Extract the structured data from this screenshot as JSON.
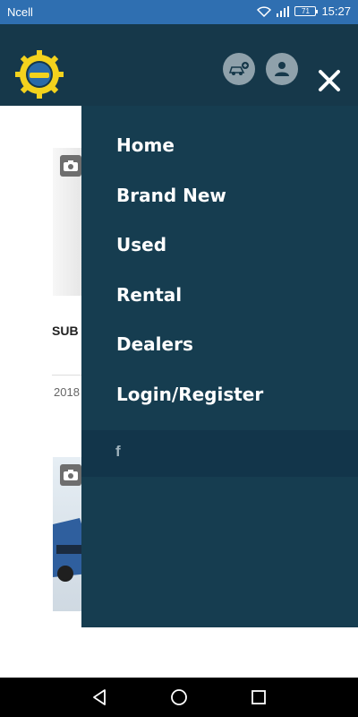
{
  "status_bar": {
    "carrier": "Ncell",
    "battery": "71",
    "time": "15:27"
  },
  "header": {
    "logo_icon": "gear-logo-icon",
    "add_car_icon": "add-car-icon",
    "user_icon": "user-icon",
    "close_icon": "close-icon"
  },
  "background": {
    "card_title": "SUB",
    "card_year": "2018"
  },
  "drawer": {
    "menu": [
      {
        "label": "Home"
      },
      {
        "label": "Brand New"
      },
      {
        "label": "Used"
      },
      {
        "label": "Rental"
      },
      {
        "label": "Dealers"
      },
      {
        "label": "Login/Register"
      }
    ],
    "social": {
      "facebook": "f"
    }
  },
  "colors": {
    "status_bar": "#2f6fb1",
    "header": "#16384a",
    "drawer": "#163d50",
    "social_bar": "#12354a"
  }
}
